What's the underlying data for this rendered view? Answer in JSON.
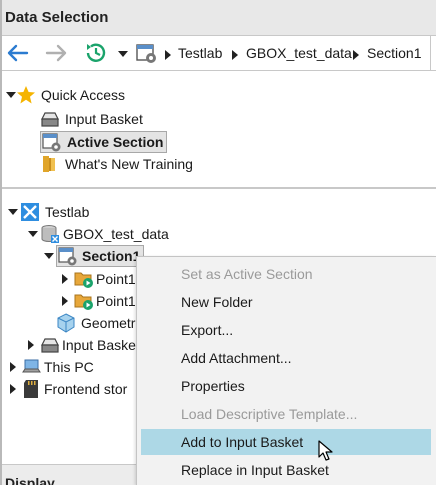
{
  "window": {
    "title": "Data Selection"
  },
  "toolbar": {
    "breadcrumbs": [
      "Testlab",
      "GBOX_test_data",
      "Section1"
    ],
    "back_icon": "arrow-left-icon",
    "forward_icon": "arrow-right-icon",
    "history_icon": "history-clock-icon",
    "location_icon": "section-icon"
  },
  "quick_access": {
    "label": "Quick Access",
    "items": [
      {
        "label": "Input Basket",
        "icon": "basket-icon"
      },
      {
        "label": "Active Section",
        "icon": "section-icon",
        "selected": true
      },
      {
        "label": "What's New Training",
        "icon": "book-icon"
      }
    ]
  },
  "tree": {
    "items": [
      {
        "label": "Testlab",
        "icon": "testlab-icon"
      },
      {
        "label": "GBOX_test_data",
        "icon": "database-icon"
      },
      {
        "label": "Section1",
        "icon": "section-icon",
        "selected": true
      },
      {
        "label": "Point1",
        "icon": "run-folder-icon"
      },
      {
        "label": "Point1",
        "icon": "run-folder-icon"
      },
      {
        "label": "Geometr",
        "icon": "cube-icon"
      },
      {
        "label": "Input Baske",
        "icon": "basket-icon"
      },
      {
        "label": "This PC",
        "icon": "computer-icon"
      },
      {
        "label": "Frontend stor",
        "icon": "sd-card-icon"
      }
    ]
  },
  "bottom_panel": {
    "label": "Display"
  },
  "context_menu": {
    "items": [
      {
        "label": "Set as Active Section",
        "enabled": false
      },
      {
        "label": "New Folder",
        "enabled": true
      },
      {
        "label": "Export...",
        "enabled": true
      },
      {
        "label": "Add Attachment...",
        "enabled": true
      },
      {
        "label": "Properties",
        "enabled": true
      },
      {
        "label": "Load Descriptive Template...",
        "enabled": false
      },
      {
        "label": "Add to Input Basket",
        "enabled": true,
        "hovered": true
      },
      {
        "label": "Replace in Input Basket",
        "enabled": true
      }
    ]
  },
  "colors": {
    "accent_blue": "#2b7bd0",
    "hover": "#add8e6",
    "history_green": "#1aa36b",
    "star": "#f5b400"
  }
}
